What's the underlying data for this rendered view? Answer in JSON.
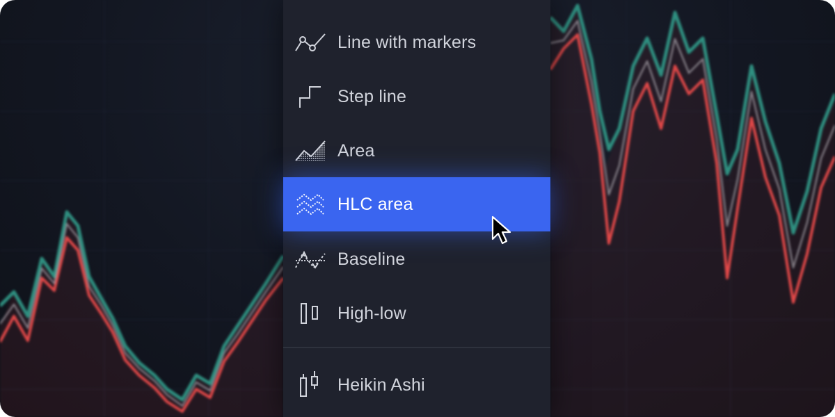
{
  "menu": {
    "items": [
      {
        "label": "Line with markers",
        "icon": "line-with-markers-icon",
        "active": false
      },
      {
        "label": "Step line",
        "icon": "step-line-icon",
        "active": false
      },
      {
        "label": "Area",
        "icon": "area-icon",
        "active": false
      },
      {
        "label": "HLC area",
        "icon": "hlc-area-icon",
        "active": true
      },
      {
        "label": "Baseline",
        "icon": "baseline-icon",
        "active": false
      },
      {
        "label": "High-low",
        "icon": "high-low-icon",
        "active": false
      },
      {
        "label": "Heikin Ashi",
        "icon": "heikin-ashi-icon",
        "active": false
      }
    ]
  },
  "colors": {
    "menu_background": "#1f222d",
    "active_item": "#3a65f0",
    "text": "#d1d4dc",
    "chart_green": "#2f8f80",
    "chart_red": "#e04848"
  }
}
